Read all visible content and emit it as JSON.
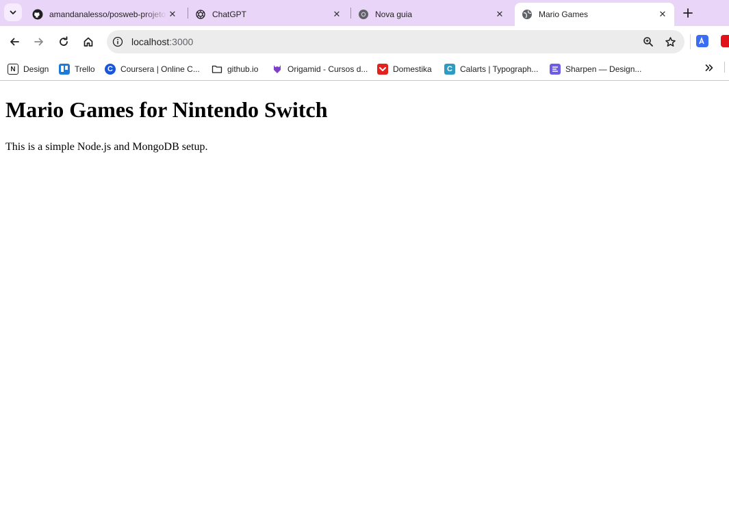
{
  "colors": {
    "tabstrip_bg": "#e9d5f7",
    "active_tab_bg": "#ffffff",
    "omnibox_bg": "#ececec"
  },
  "tabs": [
    {
      "title": "amandanalesso/posweb-projeto",
      "favicon": "github-icon",
      "active": false
    },
    {
      "title": "ChatGPT",
      "favicon": "chatgpt-icon",
      "active": false
    },
    {
      "title": "Nova guia",
      "favicon": "chrome-icon",
      "active": false
    },
    {
      "title": "Mario Games",
      "favicon": "globe-icon",
      "active": true
    }
  ],
  "toolbar": {
    "url_host": "localhost",
    "url_port": ":3000"
  },
  "bookmarks": [
    {
      "label": "Design",
      "icon": "notion-icon"
    },
    {
      "label": "Trello",
      "icon": "trello-icon"
    },
    {
      "label": "Coursera | Online C...",
      "icon": "coursera-icon"
    },
    {
      "label": "github.io",
      "icon": "folder-icon"
    },
    {
      "label": "Origamid - Cursos d...",
      "icon": "origamid-icon"
    },
    {
      "label": "Domestika",
      "icon": "domestika-icon"
    },
    {
      "label": "Calarts | Typograph...",
      "icon": "coursera-c-icon"
    },
    {
      "label": "Sharpen — Design...",
      "icon": "sharpen-icon"
    }
  ],
  "page": {
    "heading": "Mario Games for Nintendo Switch",
    "paragraph": "This is a simple Node.js and MongoDB setup."
  }
}
